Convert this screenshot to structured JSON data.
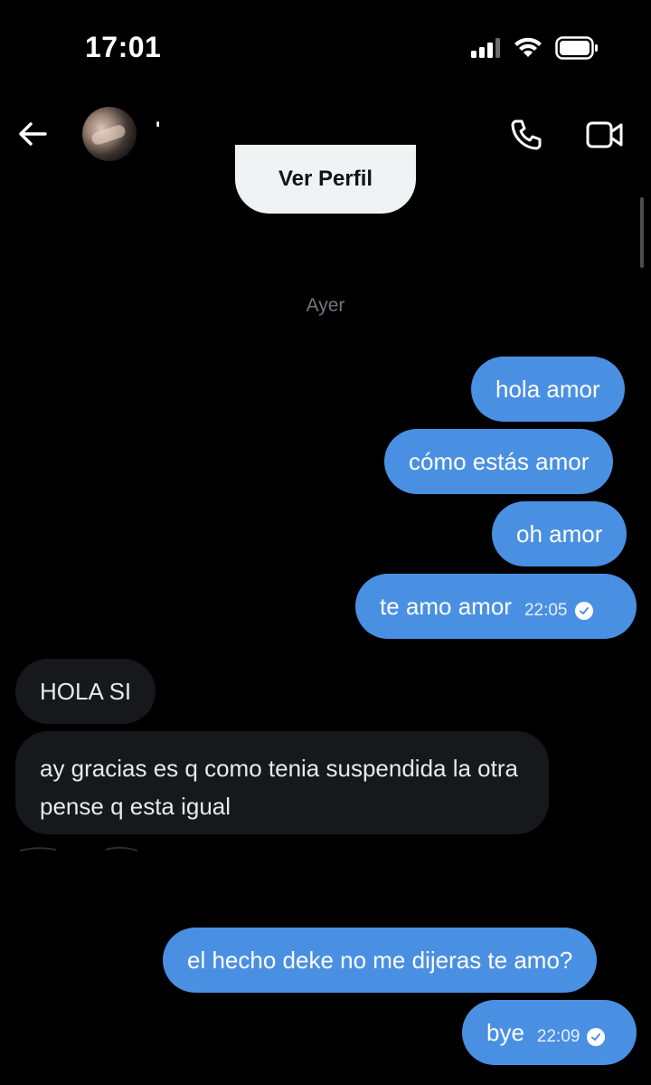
{
  "status_bar": {
    "time": "17:01"
  },
  "header": {
    "contact_name": "'"
  },
  "profile_button": {
    "label": "Ver Perfil"
  },
  "day_separator": "Ayer",
  "messages": [
    {
      "direction": "out",
      "text": "hola amor"
    },
    {
      "direction": "out",
      "text": "cómo estás amor"
    },
    {
      "direction": "out",
      "text": "oh amor"
    },
    {
      "direction": "out",
      "text": "te amo amor",
      "time": "22:05",
      "status": "read"
    },
    {
      "direction": "in",
      "text": "HOLA SI"
    },
    {
      "direction": "in",
      "text": "ay gracias es q como tenia suspendida la otra pense q esta igual"
    },
    {
      "direction": "out",
      "text": "el hecho deke no me dijeras te amo?"
    },
    {
      "direction": "out",
      "text": "bye",
      "time": "22:09",
      "status": "read"
    }
  ],
  "colors": {
    "outgoing_bubble": "#4a90e2",
    "incoming_bubble": "#16181c",
    "background": "#000000"
  }
}
